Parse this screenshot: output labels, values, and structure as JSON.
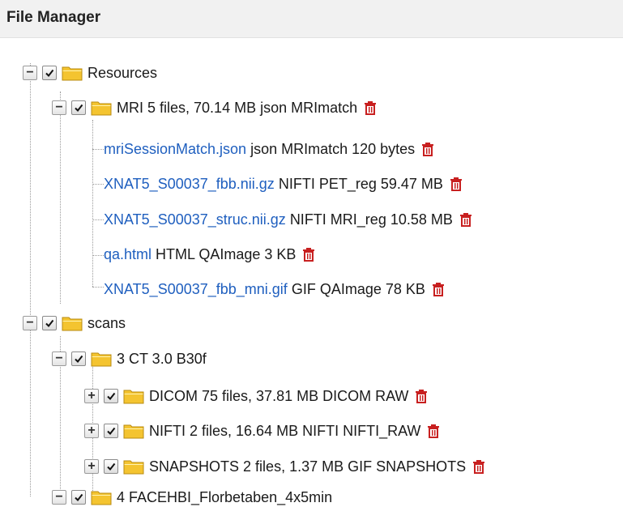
{
  "header": {
    "title": "File Manager"
  },
  "tree": {
    "resources": {
      "label": "Resources",
      "mri": {
        "label": "MRI",
        "meta": "5 files, 70.14 MB json MRImatch",
        "files": [
          {
            "name": "mriSessionMatch.json",
            "meta": "json MRImatch  120 bytes"
          },
          {
            "name": "XNAT5_S00037_fbb.nii.gz",
            "meta": "NIFTI PET_reg  59.47 MB"
          },
          {
            "name": "XNAT5_S00037_struc.nii.gz",
            "meta": "NIFTI MRI_reg  10.58 MB"
          },
          {
            "name": "qa.html",
            "meta": "HTML QAImage  3 KB"
          },
          {
            "name": "XNAT5_S00037_fbb_mni.gif",
            "meta": "GIF QAImage  78 KB"
          }
        ]
      }
    },
    "scans": {
      "label": "scans",
      "scan3": {
        "label": "3 CT 3.0 B30f",
        "children": [
          {
            "label": "DICOM",
            "meta": "75 files, 37.81 MB DICOM RAW"
          },
          {
            "label": "NIFTI",
            "meta": "2 files, 16.64 MB NIFTI NIFTI_RAW"
          },
          {
            "label": "SNAPSHOTS",
            "meta": "2 files, 1.37 MB GIF SNAPSHOTS"
          }
        ]
      },
      "scan4": {
        "label": "4 FACEHBI_Florbetaben_4x5min"
      }
    }
  },
  "icons": {
    "folder": "folder-icon",
    "checkbox": "checkmark-icon",
    "trash": "trash-icon",
    "expander_open": "minus-icon",
    "expander_closed": "plus-icon"
  },
  "colors": {
    "link": "#1f5fbf",
    "trash": "#c82020",
    "folder": "#f4c430"
  }
}
